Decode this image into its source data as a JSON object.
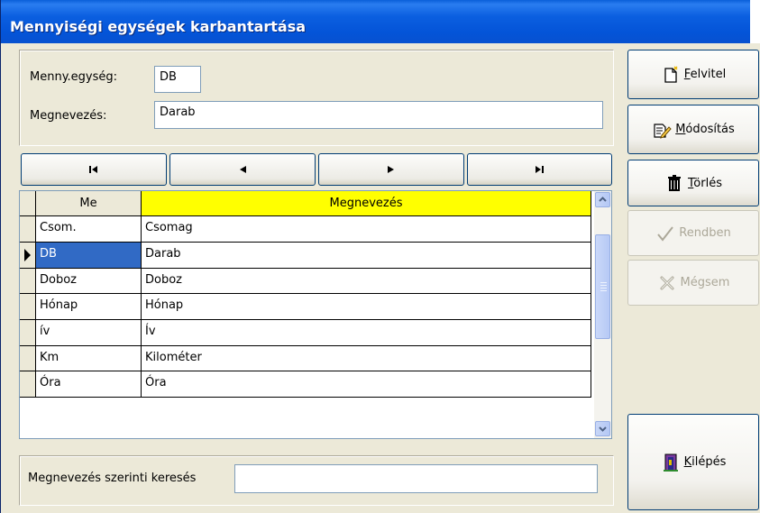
{
  "window": {
    "title": "Mennyiségi egységek karbantartása"
  },
  "fields": {
    "unit_label": "Menny.egység:",
    "unit_value": "DB",
    "name_label": "Megnevezés:",
    "name_value": "Darab"
  },
  "nav": {
    "first_icon": "first-record-icon",
    "prev_icon": "prev-record-icon",
    "next_icon": "next-record-icon",
    "last_icon": "last-record-icon"
  },
  "grid": {
    "columns": [
      "Me",
      "Megnevezés"
    ],
    "header_highlight_color": "#ffff00",
    "selection_color": "#316ac5",
    "rows": [
      {
        "me": "Csom.",
        "name": "Csomag"
      },
      {
        "me": "DB",
        "name": "Darab"
      },
      {
        "me": "Doboz",
        "name": "Doboz"
      },
      {
        "me": "Hónap",
        "name": "Hónap"
      },
      {
        "me": "ív",
        "name": "Ív"
      },
      {
        "me": "Km",
        "name": "Kilométer"
      },
      {
        "me": "Óra",
        "name": "Óra"
      }
    ]
  },
  "search": {
    "label": "Megnevezés szerinti keresés",
    "value": ""
  },
  "buttons": {
    "new_accel": "F",
    "new_rest": "elvitel",
    "modify_accel": "M",
    "modify_rest": "ódosítás",
    "delete_accel": "T",
    "delete_rest": "örlés",
    "ok": "Rendben",
    "cancel": "Mégsem",
    "exit_accel": "K",
    "exit_rest": "ilépés"
  }
}
